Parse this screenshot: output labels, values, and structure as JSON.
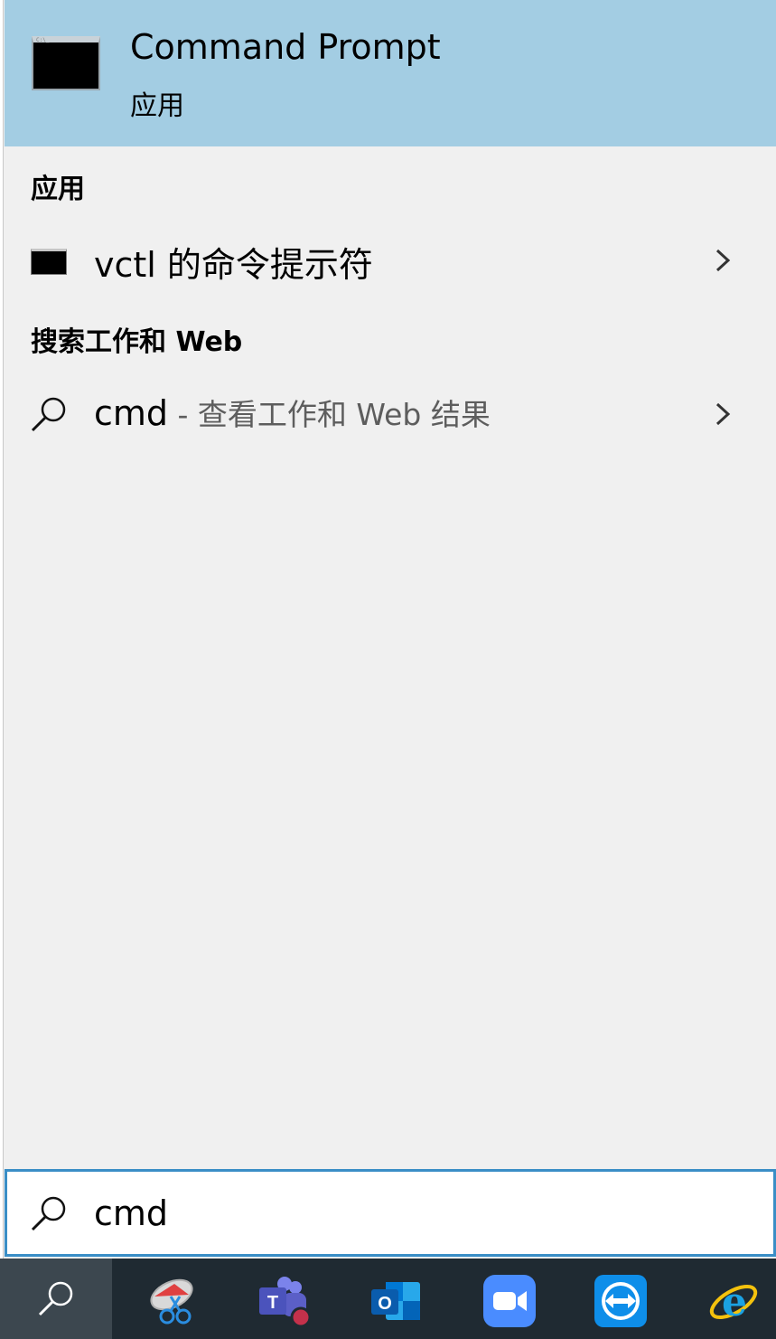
{
  "best_match": {
    "title": "Command Prompt",
    "subtitle": "应用",
    "icon": "command-prompt-icon"
  },
  "sections": {
    "apps_header": "应用",
    "apps_item": {
      "label": "vctl 的命令提示符",
      "icon": "console-icon"
    },
    "web_header": "搜索工作和 Web",
    "web_item": {
      "query": "cmd",
      "suffix": " - 查看工作和 Web 结果",
      "icon": "search-icon"
    }
  },
  "search_box": {
    "value": "cmd",
    "icon": "search-icon"
  },
  "taskbar": {
    "items": [
      {
        "icon": "search-icon"
      },
      {
        "icon": "snipping-tool-icon"
      },
      {
        "icon": "teams-icon"
      },
      {
        "icon": "outlook-icon"
      },
      {
        "icon": "zoom-icon"
      },
      {
        "icon": "teamviewer-icon"
      },
      {
        "icon": "internet-explorer-icon"
      }
    ]
  },
  "colors": {
    "highlight": "#a3cde3",
    "panel_bg": "#f0f0f0",
    "search_border": "#3a8ec6",
    "taskbar_bg": "#1f2a32"
  }
}
